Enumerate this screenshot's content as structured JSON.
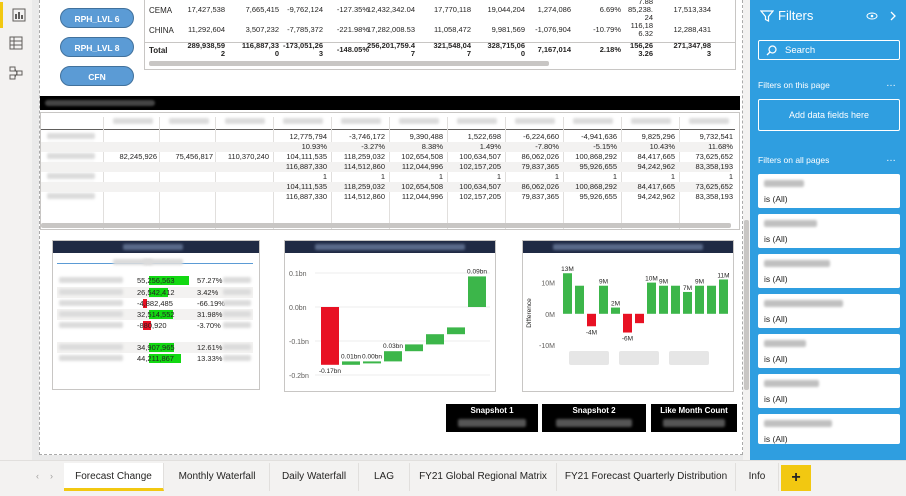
{
  "pills": [
    "RPH_LVL 6",
    "RPH_LVL 8",
    "CFN"
  ],
  "top_table": {
    "rows": [
      {
        "label": "CEMA",
        "cells": [
          "17,427,538",
          "7,665,415",
          "-9,762,124",
          "-127.35%",
          "12,432,342.04",
          "17,770,118",
          "19,044,204",
          "1,274,086",
          "6.69%",
          "7.88\n85,238.\n24",
          "17,513,334"
        ]
      },
      {
        "label": "CHINA",
        "cells": [
          "11,292,604",
          "3,507,232",
          "-7,785,372",
          "-221.98%",
          "17,282,008.53",
          "11,058,472",
          "9,981,569",
          "-1,076,904",
          "-10.79%",
          "116,18\n6.32",
          "12,288,431"
        ]
      },
      {
        "label": "Total",
        "cells": [
          "289,938,59\n2",
          "116,887,33\n0",
          "-173,051,26\n3",
          "-148.05%",
          "256,201,759.4\n7",
          "321,548,04\n7",
          "328,715,06\n0",
          "7,167,014",
          "2.18%",
          "156,26\n3.26",
          "271,347,98\n3"
        ]
      }
    ]
  },
  "mid_table": {
    "rows": [
      [
        "",
        "",
        "",
        "12,775,794",
        "-3,746,172",
        "9,390,488",
        "1,522,698",
        "-6,224,660",
        "-4,941,636",
        "9,825,296",
        "9,732,541"
      ],
      [
        "",
        "",
        "",
        "10.93%",
        "-3.27%",
        "8.38%",
        "1.49%",
        "-7.80%",
        "-5.15%",
        "10.43%",
        "11.68%"
      ],
      [
        "82,245,926",
        "75,456,817",
        "110,370,240",
        "104,111,535",
        "118,259,032",
        "102,654,508",
        "100,634,507",
        "86,062,026",
        "100,868,292",
        "84,417,665",
        "73,625,652"
      ],
      [
        "",
        "",
        "",
        "116,887,330",
        "114,512,860",
        "112,044,996",
        "102,157,205",
        "79,837,365",
        "95,926,655",
        "94,242,962",
        "83,358,193"
      ],
      [
        "",
        "",
        "",
        "1",
        "1",
        "1",
        "1",
        "1",
        "1",
        "1",
        "1"
      ],
      [
        "",
        "",
        "",
        "104,111,535",
        "118,259,032",
        "102,654,508",
        "100,634,507",
        "86,062,026",
        "100,868,292",
        "84,417,665",
        "73,625,652"
      ],
      [
        "",
        "",
        "",
        "116,887,330",
        "114,512,860",
        "112,044,996",
        "102,157,205",
        "79,837,365",
        "95,926,655",
        "94,242,962",
        "83,358,193"
      ]
    ]
  },
  "card1": {
    "rows": [
      {
        "value": "55,256,563",
        "pct": "57.27%",
        "bar": "green",
        "size": 0.57
      },
      {
        "value": "26,542,412",
        "pct": "3.42%",
        "bar": "green",
        "size": 0.27
      },
      {
        "value": "-4,882,485",
        "pct": "-66.19%",
        "bar": "red",
        "size": 0.06
      },
      {
        "value": "32,514,552",
        "pct": "31.98%",
        "bar": "green",
        "size": 0.34
      },
      {
        "value": "-880,920",
        "pct": "-3.70%",
        "bar": "red",
        "size": 0.12
      },
      {
        "value": "34,907,965",
        "pct": "12.61%",
        "bar": "green",
        "size": 0.36
      },
      {
        "value": "44,211,867",
        "pct": "13.33%",
        "bar": "green",
        "size": 0.46
      }
    ]
  },
  "chart_data": [
    {
      "type": "bar",
      "title": "",
      "ylim": [
        -0.2,
        0.1
      ],
      "yticks": [
        "0.1bn",
        "0.0bn",
        "-0.1bn",
        "-0.2bn"
      ],
      "values": [
        -0.17,
        0.01,
        0.0,
        0.03,
        0.02,
        0.03,
        0.02,
        0.09
      ],
      "labels": [
        "-0.17bn",
        "0.01bn",
        "0.00bn",
        "0.03bn",
        "",
        "",
        "",
        "0.09bn"
      ]
    },
    {
      "type": "bar",
      "title": "",
      "ylabel": "Difference",
      "ylim": [
        -10,
        15
      ],
      "yticks": [
        "10M",
        "0M",
        "-10M"
      ],
      "values": [
        13,
        9,
        -4,
        9,
        2,
        -6,
        -3,
        10,
        9,
        9,
        7,
        9,
        9,
        11
      ],
      "labels": [
        "13M",
        "",
        "-4M",
        "9M",
        "2M",
        "-6M",
        "",
        "10M",
        "9M",
        "",
        "7M",
        "9M",
        "",
        "11M"
      ]
    }
  ],
  "snapshots": [
    "Snapshot 1",
    "Snapshot 2",
    "Like Month Count"
  ],
  "filters": {
    "title": "Filters",
    "search_placeholder": "Search",
    "on_this_page": "Filters on this page",
    "add_fields": "Add data fields here",
    "on_all_pages": "Filters on all pages",
    "cards": [
      "is (All)",
      "is (All)",
      "is (All)",
      "is (All)",
      "is (All)",
      "is (All)",
      "is (All)"
    ]
  },
  "tabs": [
    "Forecast Change",
    "Monthly Waterfall",
    "Daily Waterfall",
    "LAG",
    "FY21 Global Regional Matrix",
    "FY21 Forecast Quarterly Distribution",
    "Info"
  ],
  "colors": {
    "accent": "#f2c811",
    "filter_pane": "#2f9ee0",
    "pill": "#5b9bd5",
    "green": "#12d812",
    "red": "#e81123",
    "waterfall_green": "#3cb64a"
  }
}
